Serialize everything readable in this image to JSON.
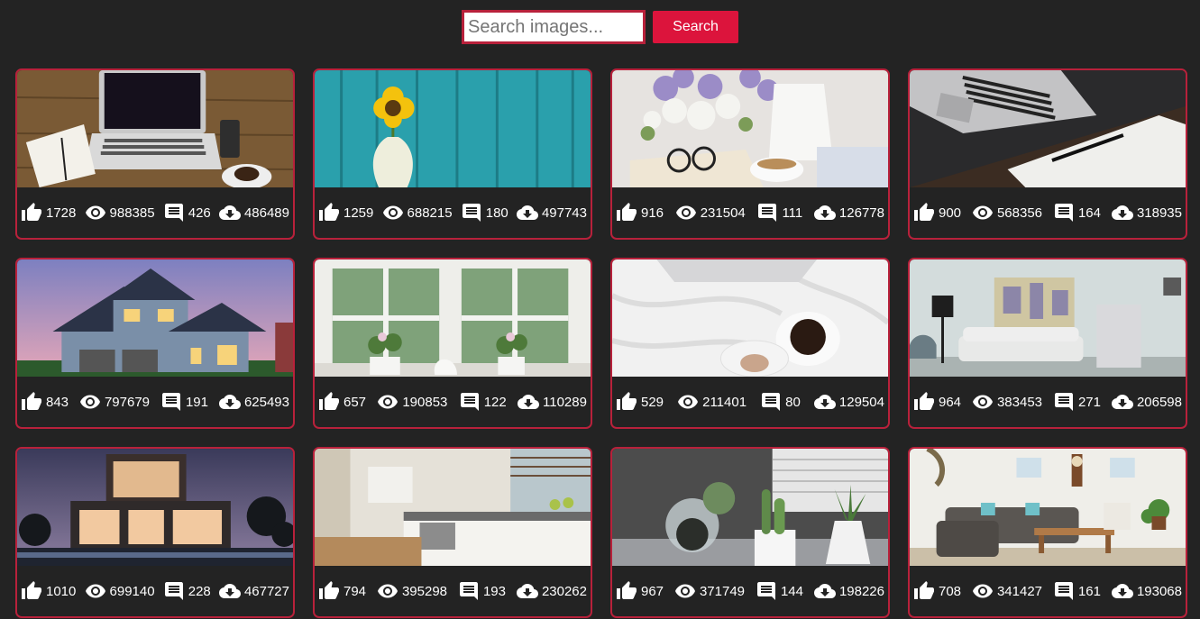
{
  "search": {
    "placeholder": "Search images...",
    "value": "",
    "button_label": "Search"
  },
  "colors": {
    "background": "#232323",
    "accent": "#dc143c",
    "card_border": "#b8213b"
  },
  "icons": {
    "likes": "thumbs-up-icon",
    "views": "eye-icon",
    "comments": "comment-icon",
    "downloads": "cloud-download-icon"
  },
  "images": [
    {
      "subject": "laptop-on-wooden-desk",
      "likes": "1728",
      "views": "988385",
      "comments": "426",
      "downloads": "486489"
    },
    {
      "subject": "sunflower-vase-teal-wall",
      "likes": "1259",
      "views": "688215",
      "comments": "180",
      "downloads": "497743"
    },
    {
      "subject": "lilacs-book-glasses-teacup",
      "likes": "916",
      "views": "231504",
      "comments": "111",
      "downloads": "126778"
    },
    {
      "subject": "laptop-notebook-pen",
      "likes": "900",
      "views": "568356",
      "comments": "164",
      "downloads": "318935"
    },
    {
      "subject": "house-at-dusk",
      "likes": "843",
      "views": "797679",
      "comments": "191",
      "downloads": "625493"
    },
    {
      "subject": "window-flower-pots",
      "likes": "657",
      "views": "190853",
      "comments": "122",
      "downloads": "110289"
    },
    {
      "subject": "coffee-on-white-bed",
      "likes": "529",
      "views": "211401",
      "comments": "80",
      "downloads": "129504"
    },
    {
      "subject": "living-room-sofa-lamp",
      "likes": "964",
      "views": "383453",
      "comments": "271",
      "downloads": "206598"
    },
    {
      "subject": "modern-house-night",
      "likes": "1010",
      "views": "699140",
      "comments": "228",
      "downloads": "467727"
    },
    {
      "subject": "white-kitchen",
      "likes": "794",
      "views": "395298",
      "comments": "193",
      "downloads": "230262"
    },
    {
      "subject": "cactus-succulents",
      "likes": "967",
      "views": "371749",
      "comments": "144",
      "downloads": "198226"
    },
    {
      "subject": "cozy-living-room",
      "likes": "708",
      "views": "341427",
      "comments": "161",
      "downloads": "193068"
    }
  ]
}
